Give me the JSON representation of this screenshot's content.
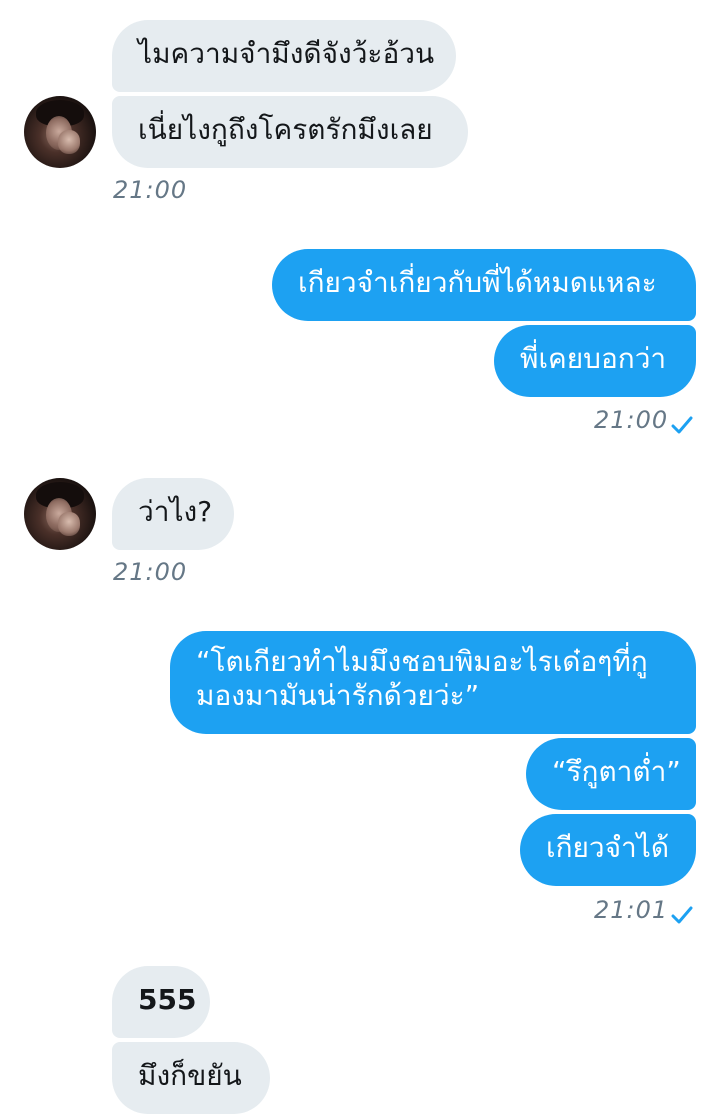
{
  "messages": {
    "m1": "ไมความจำมึงดีจังว้ะอ้วน",
    "m2": "เนี่ยไงกูถึงโครตรักมึงเลย",
    "m3": "เกียวจำเกี่ยวกับพี่ได้หมดแหละ",
    "m4": "พี่เคยบอกว่า",
    "m5": "ว่าไง?",
    "m6": "“โตเกียวทำไมมึงชอบพิมอะไรเด๋อๆที่กูมองมามันน่ารักด้วยว่ะ”",
    "m7": "“รึกูตาต่ำ”",
    "m8": "เกียวจำได้",
    "m9": "555",
    "m10": "มึงก็ขยัน"
  },
  "timestamps": {
    "t1": "21:00",
    "t2": "21:00",
    "t3": "21:00",
    "t4": "21:01"
  },
  "icons": {
    "read_receipt": "checkmark-icon",
    "avatar": "contact-avatar"
  },
  "colors": {
    "outgoing_bubble": "#1da1f2",
    "incoming_bubble": "#e6ecf0",
    "timestamp_text": "#657786"
  }
}
